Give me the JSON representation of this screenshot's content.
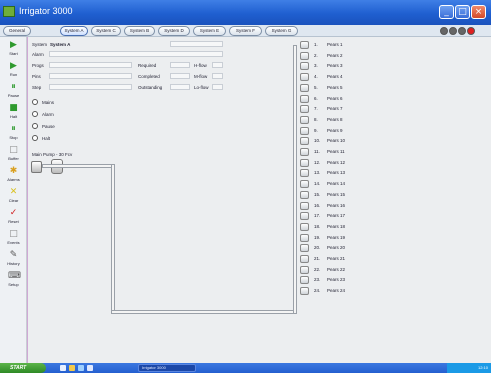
{
  "window": {
    "title": "Irrigator 3000",
    "min": "_",
    "max": "□",
    "close": "×"
  },
  "toolbar": {
    "general": "General",
    "tabs": [
      "System A",
      "System C",
      "System B",
      "System D",
      "System E",
      "System F",
      "System G"
    ],
    "status_colors": [
      "#666666",
      "#666666",
      "#666666",
      "#e02020"
    ]
  },
  "sidebar": {
    "items": [
      {
        "label": "Start",
        "icon": "▶",
        "color": "#2e9a2e"
      },
      {
        "label": "Run",
        "icon": "▶",
        "color": "#2e9a2e"
      },
      {
        "label": "Pause",
        "icon": "⏸",
        "color": "#2e9a2e"
      },
      {
        "label": "Halt",
        "icon": "■",
        "color": "#2e9a2e"
      },
      {
        "label": "Stop",
        "icon": "⏸",
        "color": "#2e9a2e"
      },
      {
        "label": "Buffer",
        "icon": "□",
        "color": "#888888"
      },
      {
        "label": "Alarms",
        "icon": "✱",
        "color": "#d9a020"
      },
      {
        "label": "Clear",
        "icon": "✕",
        "color": "#d9c020"
      },
      {
        "label": "Reset",
        "icon": "✓",
        "color": "#d02020"
      },
      {
        "label": "Events",
        "icon": "□",
        "color": "#888888"
      },
      {
        "label": "History",
        "icon": "✎",
        "color": "#555555"
      },
      {
        "label": "Setup",
        "icon": "⌨",
        "color": "#555555"
      }
    ]
  },
  "main": {
    "system_label": "System",
    "system_value": "System A",
    "alarm_label": "Alarm",
    "rows": [
      {
        "label": "Progs",
        "mid": "Required",
        "right": "H-flow"
      },
      {
        "label": "Pins",
        "mid": "Completed",
        "right": "M-flow"
      },
      {
        "label": "Step",
        "mid": "Outstanding",
        "right": "Lo-flow"
      }
    ],
    "radios": [
      "Mains",
      "Alarm",
      "Pause",
      "Halt"
    ],
    "pump_label": "Main Pump - 30 Fcv"
  },
  "zones": [
    {
      "num": "1.",
      "name": "Pears 1"
    },
    {
      "num": "2.",
      "name": "Pears 2"
    },
    {
      "num": "3.",
      "name": "Pears 3"
    },
    {
      "num": "4.",
      "name": "Pears 4"
    },
    {
      "num": "5.",
      "name": "Pears 5"
    },
    {
      "num": "6.",
      "name": "Pears 6"
    },
    {
      "num": "7.",
      "name": "Pears 7"
    },
    {
      "num": "8.",
      "name": "Pears 8"
    },
    {
      "num": "9.",
      "name": "Pears 9"
    },
    {
      "num": "10.",
      "name": "Pears 10"
    },
    {
      "num": "11.",
      "name": "Pears 11"
    },
    {
      "num": "12.",
      "name": "Pears 12"
    },
    {
      "num": "13.",
      "name": "Pears 13"
    },
    {
      "num": "14.",
      "name": "Pears 14"
    },
    {
      "num": "15.",
      "name": "Pears 15"
    },
    {
      "num": "16.",
      "name": "Pears 16"
    },
    {
      "num": "17.",
      "name": "Pears 17"
    },
    {
      "num": "18.",
      "name": "Pears 18"
    },
    {
      "num": "19.",
      "name": "Pears 19"
    },
    {
      "num": "20.",
      "name": "Pears 20"
    },
    {
      "num": "21.",
      "name": "Pears 21"
    },
    {
      "num": "22.",
      "name": "Pears 22"
    },
    {
      "num": "23.",
      "name": "Pears 23"
    },
    {
      "num": "24.",
      "name": "Pears 24"
    }
  ],
  "taskbar": {
    "start": "START",
    "app": "Irrigator 3000",
    "clock": "12:10"
  }
}
